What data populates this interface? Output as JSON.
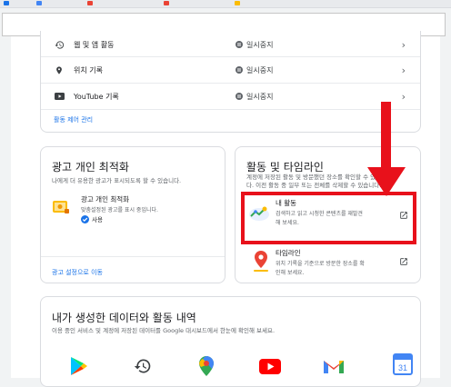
{
  "activity_controls": {
    "rows": [
      {
        "label": "웹 및 앱 활동",
        "status": "일시중지"
      },
      {
        "label": "위치 기록",
        "status": "일시중지"
      },
      {
        "label": "YouTube 기록",
        "status": "일시중지"
      }
    ],
    "manage_link": "활동 제어 관리"
  },
  "ads_card": {
    "title": "광고 개인 최적화",
    "description": "나에게 더 유용한 광고가 표시되도록 할 수 있습니다.",
    "item_title": "광고 개인 최적화",
    "item_desc": "맞춤설정된 광고를 표시 중입니다.",
    "item_status": "사용",
    "settings_link": "광고 설정으로 이동"
  },
  "activity_card": {
    "title": "활동 및 타임라인",
    "description_line1": "계정에 저장된 활동 및 방문했던 장소를 확인할 수 있습니",
    "description_line2": "다. 이전 활동 중 일부 또는 전체를 삭제할 수 있습니다.",
    "my_activity_title": "내 활동",
    "my_activity_desc1": "검색하고 읽고 시청한 콘텐츠를 재발견",
    "my_activity_desc2": "해 보세요.",
    "timeline_title": "타임라인",
    "timeline_desc1": "위치 기록을 기준으로 방문한 장소를 확",
    "timeline_desc2": "인해 보세요."
  },
  "data_section": {
    "title": "내가 생성한 데이터와 활동 내역",
    "description": "이용 중인 서비스 및 계정에 저장된 데이터를 Google 대시보드에서 한눈에 확인해 보세요.",
    "apps": [
      {
        "icon": "play-store-icon"
      },
      {
        "icon": "history-icon"
      },
      {
        "icon": "maps-icon"
      },
      {
        "icon": "youtube-icon"
      },
      {
        "icon": "gmail-icon"
      },
      {
        "icon": "calendar-icon",
        "text": "31"
      }
    ]
  },
  "colors": {
    "accent": "#1a73e8",
    "annotation_red": "#e8111b",
    "status_dot": "#5f6368"
  }
}
